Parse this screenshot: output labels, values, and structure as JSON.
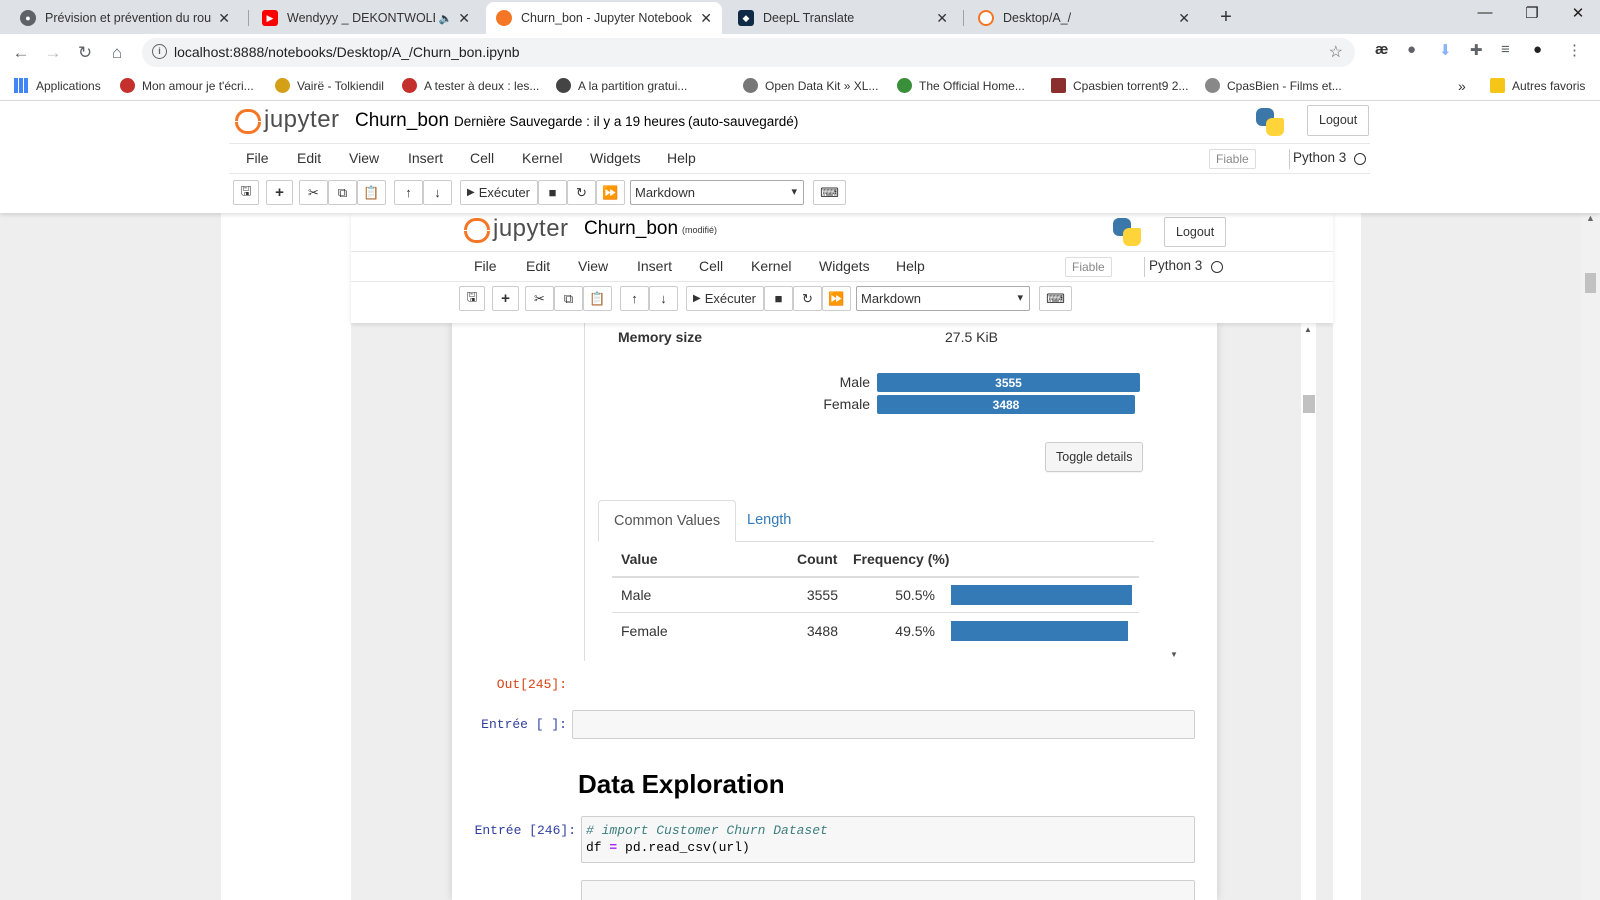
{
  "browser": {
    "tabs": [
      {
        "title": "Prévision et prévention du roulem",
        "icon": "globe-icon",
        "color": "#5f6368"
      },
      {
        "title": "Wendyyy _ DEKONTWOLE_(",
        "icon": "youtube-icon",
        "color": "#ff0000"
      },
      {
        "title": "Churn_bon - Jupyter Notebook",
        "icon": "jupyter-icon",
        "color": "#f37726"
      },
      {
        "title": "DeepL Translate",
        "icon": "deepl-icon",
        "color": "#0f2b46"
      },
      {
        "title": "Desktop/A_/",
        "icon": "jupyter-icon",
        "color": "#f37726"
      }
    ],
    "active_tab": 2,
    "new_tab": "+",
    "url": "localhost:8888/notebooks/Desktop/A_/Churn_bon.ipynb",
    "window_controls": [
      "—",
      "❐",
      "✕"
    ],
    "bookmarks": [
      {
        "label": "Applications",
        "color": "#4285f4"
      },
      {
        "label": "Mon amour je t'écri...",
        "color": "#c4302b"
      },
      {
        "label": "Vairë - Tolkiendil",
        "color": "#d4a017"
      },
      {
        "label": "A tester à deux : les...",
        "color": "#c4302b"
      },
      {
        "label": "A la partition gratui...",
        "color": "#444444"
      },
      {
        "label": "Open Data Kit » XL...",
        "color": "#777777"
      },
      {
        "label": "The Official Home...",
        "color": "#3a8f3a"
      },
      {
        "label": "Cpasbien torrent9 2...",
        "color": "#8b2e2e"
      },
      {
        "label": "CpasBien - Films et...",
        "color": "#888888"
      }
    ],
    "bookmarks_more": "»",
    "other_bookmarks": "Autres favoris"
  },
  "jupyter": {
    "logo_text": "jupyter",
    "notebook_name": "Churn_bon",
    "save_status": "Dernière Sauvegarde : il y a 19 heures",
    "autosave": "(auto-sauvegardé)",
    "logout": "Logout",
    "menu": [
      "File",
      "Edit",
      "View",
      "Insert",
      "Cell",
      "Kernel",
      "Widgets",
      "Help"
    ],
    "trusted": "Fiable",
    "kernel": "Python 3",
    "run_label": "Exécuter",
    "cell_type": "Markdown"
  },
  "inner_jupyter": {
    "logo_text": "jupyter",
    "notebook_name": "Churn_bon",
    "modified": "(modifié)",
    "logout": "Logout",
    "menu": [
      "File",
      "Edit",
      "View",
      "Insert",
      "Cell",
      "Kernel",
      "Widgets",
      "Help"
    ],
    "trusted": "Fiable",
    "kernel": "Python 3",
    "run_label": "Exécuter",
    "cell_type": "Markdown"
  },
  "profile": {
    "memory_label": "Memory size",
    "memory_value": "27.5 KiB",
    "mini_bars": [
      {
        "label": "Male",
        "value": 3555
      },
      {
        "label": "Female",
        "value": 3488
      }
    ],
    "toggle_details": "Toggle details",
    "tabs": [
      "Common Values",
      "Length"
    ],
    "table_headers": [
      "Value",
      "Count",
      "Frequency (%)"
    ],
    "rows": [
      {
        "value": "Male",
        "count": "3555",
        "freq": "50.5%",
        "fraction": 0.505
      },
      {
        "value": "Female",
        "count": "3488",
        "freq": "49.5%",
        "fraction": 0.495
      }
    ]
  },
  "cells": {
    "out_prompt": "Out[245]:",
    "empty_prompt": "Entrée [ ]:",
    "heading": "Data Exploration",
    "code_prompt": "Entrée [246]:",
    "code_comment": "# import Customer Churn Dataset",
    "code_line2_a": "df ",
    "code_line2_op": "=",
    "code_line2_b": " pd.read_csv(url)"
  }
}
